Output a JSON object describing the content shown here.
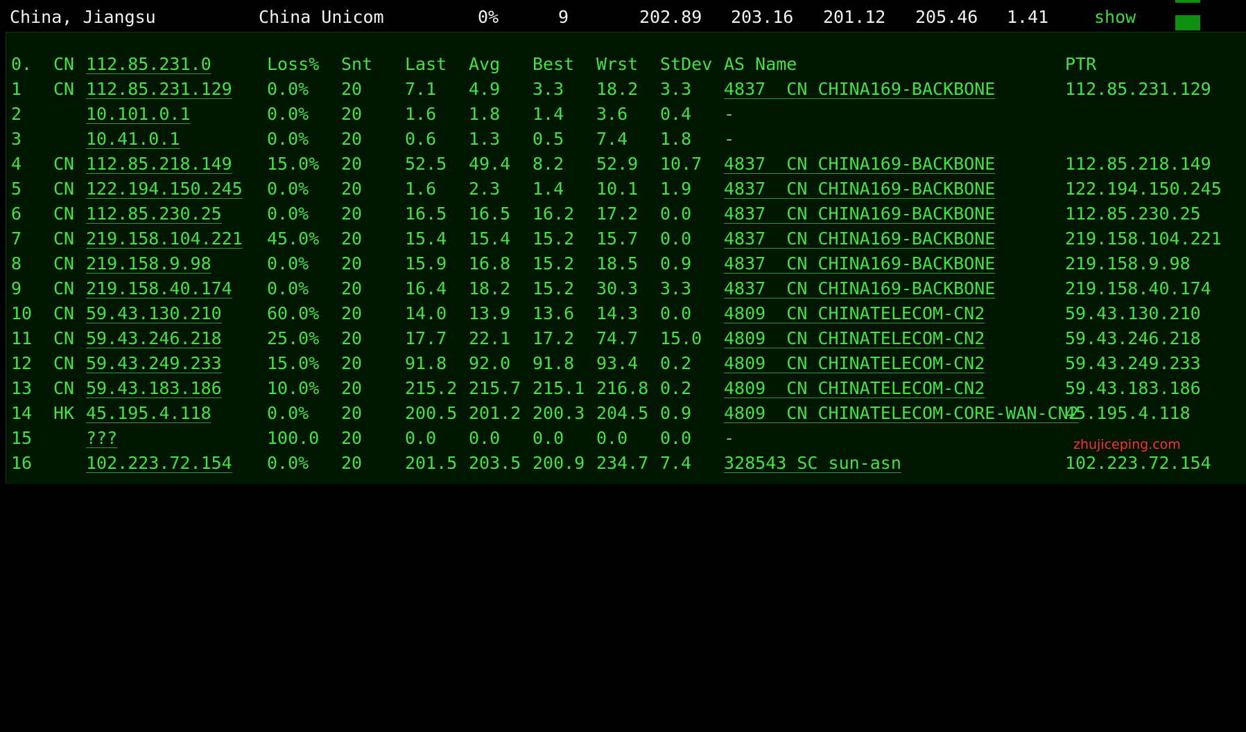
{
  "summary": {
    "location": "China, Jiangsu",
    "isp": "China Unicom",
    "loss": "0%",
    "sent": "9",
    "last": "202.89",
    "avg": "203.16",
    "best": "201.12",
    "worst": "205.46",
    "stdev": "1.41",
    "show_label": "show"
  },
  "trace": {
    "header": {
      "hop": "0.",
      "cc": "CN",
      "ip": "112.85.231.0",
      "loss": "Loss%",
      "snt": "Snt",
      "last": "Last",
      "avg": "Avg",
      "best": "Best",
      "wrst": "Wrst",
      "stdev": "StDev",
      "as": "AS Name",
      "ptr": "PTR"
    },
    "rows": [
      {
        "hop": "1",
        "cc": "CN",
        "ip": "112.85.231.129",
        "loss": "0.0%",
        "snt": "20",
        "last": "7.1",
        "avg": "4.9",
        "best": "3.3",
        "wrst": "18.2",
        "stdev": "3.3",
        "as": "4837  CN CHINA169-BACKBONE",
        "ptr": "112.85.231.129"
      },
      {
        "hop": "2",
        "cc": "",
        "ip": "10.101.0.1",
        "loss": "0.0%",
        "snt": "20",
        "last": "1.6",
        "avg": "1.8",
        "best": "1.4",
        "wrst": "3.6",
        "stdev": "0.4",
        "as": "-",
        "ptr": ""
      },
      {
        "hop": "3",
        "cc": "",
        "ip": "10.41.0.1",
        "loss": "0.0%",
        "snt": "20",
        "last": "0.6",
        "avg": "1.3",
        "best": "0.5",
        "wrst": "7.4",
        "stdev": "1.8",
        "as": "-",
        "ptr": ""
      },
      {
        "hop": "4",
        "cc": "CN",
        "ip": "112.85.218.149",
        "loss": "15.0%",
        "snt": "20",
        "last": "52.5",
        "avg": "49.4",
        "best": "8.2",
        "wrst": "52.9",
        "stdev": "10.7",
        "as": "4837  CN CHINA169-BACKBONE",
        "ptr": "112.85.218.149"
      },
      {
        "hop": "5",
        "cc": "CN",
        "ip": "122.194.150.245",
        "loss": "0.0%",
        "snt": "20",
        "last": "1.6",
        "avg": "2.3",
        "best": "1.4",
        "wrst": "10.1",
        "stdev": "1.9",
        "as": "4837  CN CHINA169-BACKBONE",
        "ptr": "122.194.150.245"
      },
      {
        "hop": "6",
        "cc": "CN",
        "ip": "112.85.230.25",
        "loss": "0.0%",
        "snt": "20",
        "last": "16.5",
        "avg": "16.5",
        "best": "16.2",
        "wrst": "17.2",
        "stdev": "0.0",
        "as": "4837  CN CHINA169-BACKBONE",
        "ptr": "112.85.230.25"
      },
      {
        "hop": "7",
        "cc": "CN",
        "ip": "219.158.104.221",
        "loss": "45.0%",
        "snt": "20",
        "last": "15.4",
        "avg": "15.4",
        "best": "15.2",
        "wrst": "15.7",
        "stdev": "0.0",
        "as": "4837  CN CHINA169-BACKBONE",
        "ptr": "219.158.104.221"
      },
      {
        "hop": "8",
        "cc": "CN",
        "ip": "219.158.9.98",
        "loss": "0.0%",
        "snt": "20",
        "last": "15.9",
        "avg": "16.8",
        "best": "15.2",
        "wrst": "18.5",
        "stdev": "0.9",
        "as": "4837  CN CHINA169-BACKBONE",
        "ptr": "219.158.9.98"
      },
      {
        "hop": "9",
        "cc": "CN",
        "ip": "219.158.40.174",
        "loss": "0.0%",
        "snt": "20",
        "last": "16.4",
        "avg": "18.2",
        "best": "15.2",
        "wrst": "30.3",
        "stdev": "3.3",
        "as": "4837  CN CHINA169-BACKBONE",
        "ptr": "219.158.40.174"
      },
      {
        "hop": "10",
        "cc": "CN",
        "ip": "59.43.130.210",
        "loss": "60.0%",
        "snt": "20",
        "last": "14.0",
        "avg": "13.9",
        "best": "13.6",
        "wrst": "14.3",
        "stdev": "0.0",
        "as": "4809  CN CHINATELECOM-CN2",
        "ptr": "59.43.130.210"
      },
      {
        "hop": "11",
        "cc": "CN",
        "ip": "59.43.246.218",
        "loss": "25.0%",
        "snt": "20",
        "last": "17.7",
        "avg": "22.1",
        "best": "17.2",
        "wrst": "74.7",
        "stdev": "15.0",
        "as": "4809  CN CHINATELECOM-CN2",
        "ptr": "59.43.246.218"
      },
      {
        "hop": "12",
        "cc": "CN",
        "ip": "59.43.249.233",
        "loss": "15.0%",
        "snt": "20",
        "last": "91.8",
        "avg": "92.0",
        "best": "91.8",
        "wrst": "93.4",
        "stdev": "0.2",
        "as": "4809  CN CHINATELECOM-CN2",
        "ptr": "59.43.249.233"
      },
      {
        "hop": "13",
        "cc": "CN",
        "ip": "59.43.183.186",
        "loss": "10.0%",
        "snt": "20",
        "last": "215.2",
        "avg": "215.7",
        "best": "215.1",
        "wrst": "216.8",
        "stdev": "0.2",
        "as": "4809  CN CHINATELECOM-CN2",
        "ptr": "59.43.183.186"
      },
      {
        "hop": "14",
        "cc": "HK",
        "ip": "45.195.4.118",
        "loss": "0.0%",
        "snt": "20",
        "last": "200.5",
        "avg": "201.2",
        "best": "200.3",
        "wrst": "204.5",
        "stdev": "0.9",
        "as": "4809  CN CHINATELECOM-CORE-WAN-CN2",
        "ptr": "45.195.4.118"
      },
      {
        "hop": "15",
        "cc": "",
        "ip": "???",
        "loss": "100.0",
        "snt": "20",
        "last": "0.0",
        "avg": "0.0",
        "best": "0.0",
        "wrst": "0.0",
        "stdev": "0.0",
        "as": "-",
        "ptr": ""
      },
      {
        "hop": "16",
        "cc": "",
        "ip": "102.223.72.154",
        "loss": "0.0%",
        "snt": "20",
        "last": "201.5",
        "avg": "203.5",
        "best": "200.9",
        "wrst": "234.7",
        "stdev": "7.4",
        "as": "328543 SC sun-asn",
        "ptr": "102.223.72.154"
      }
    ]
  },
  "watermark": "zhujiceping.com"
}
